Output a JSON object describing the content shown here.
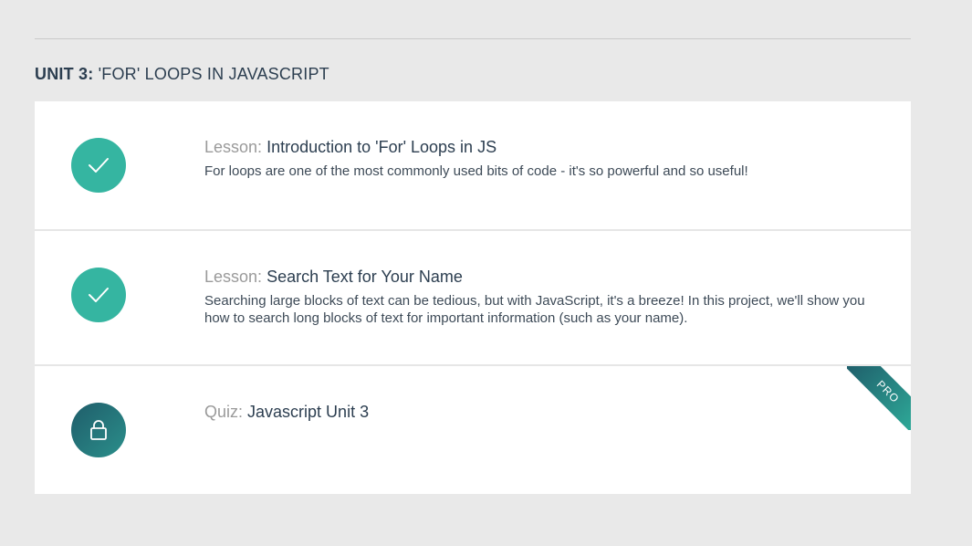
{
  "unit": {
    "number_label": "UNIT 3:",
    "title": "'FOR' LOOPS IN JAVASCRIPT"
  },
  "items": [
    {
      "kind": "Lesson:",
      "name": "Introduction to 'For' Loops in JS",
      "description": "For loops are one of the most commonly used bits of code - it's so powerful and so useful!",
      "status_icon": "check-icon",
      "status": "completed"
    },
    {
      "kind": "Lesson:",
      "name": "Search Text for Your Name",
      "description": "Searching large blocks of text can be tedious, but with JavaScript, it's a breeze! In this project, we'll show you how to search long blocks of text for important information (such as your name).",
      "status_icon": "check-icon",
      "status": "completed"
    },
    {
      "kind": "Quiz:",
      "name": "Javascript Unit 3",
      "description": "",
      "status_icon": "lock-icon",
      "status": "locked",
      "ribbon": "PRO"
    }
  ],
  "colors": {
    "page_background": "#e9e9e9",
    "completed_accent": "#35b5a1",
    "locked_gradient_start": "#1f5d6a",
    "locked_gradient_end": "#2b8f8b",
    "kind_label": "#9a9a9a",
    "text": "#2c3e50"
  }
}
